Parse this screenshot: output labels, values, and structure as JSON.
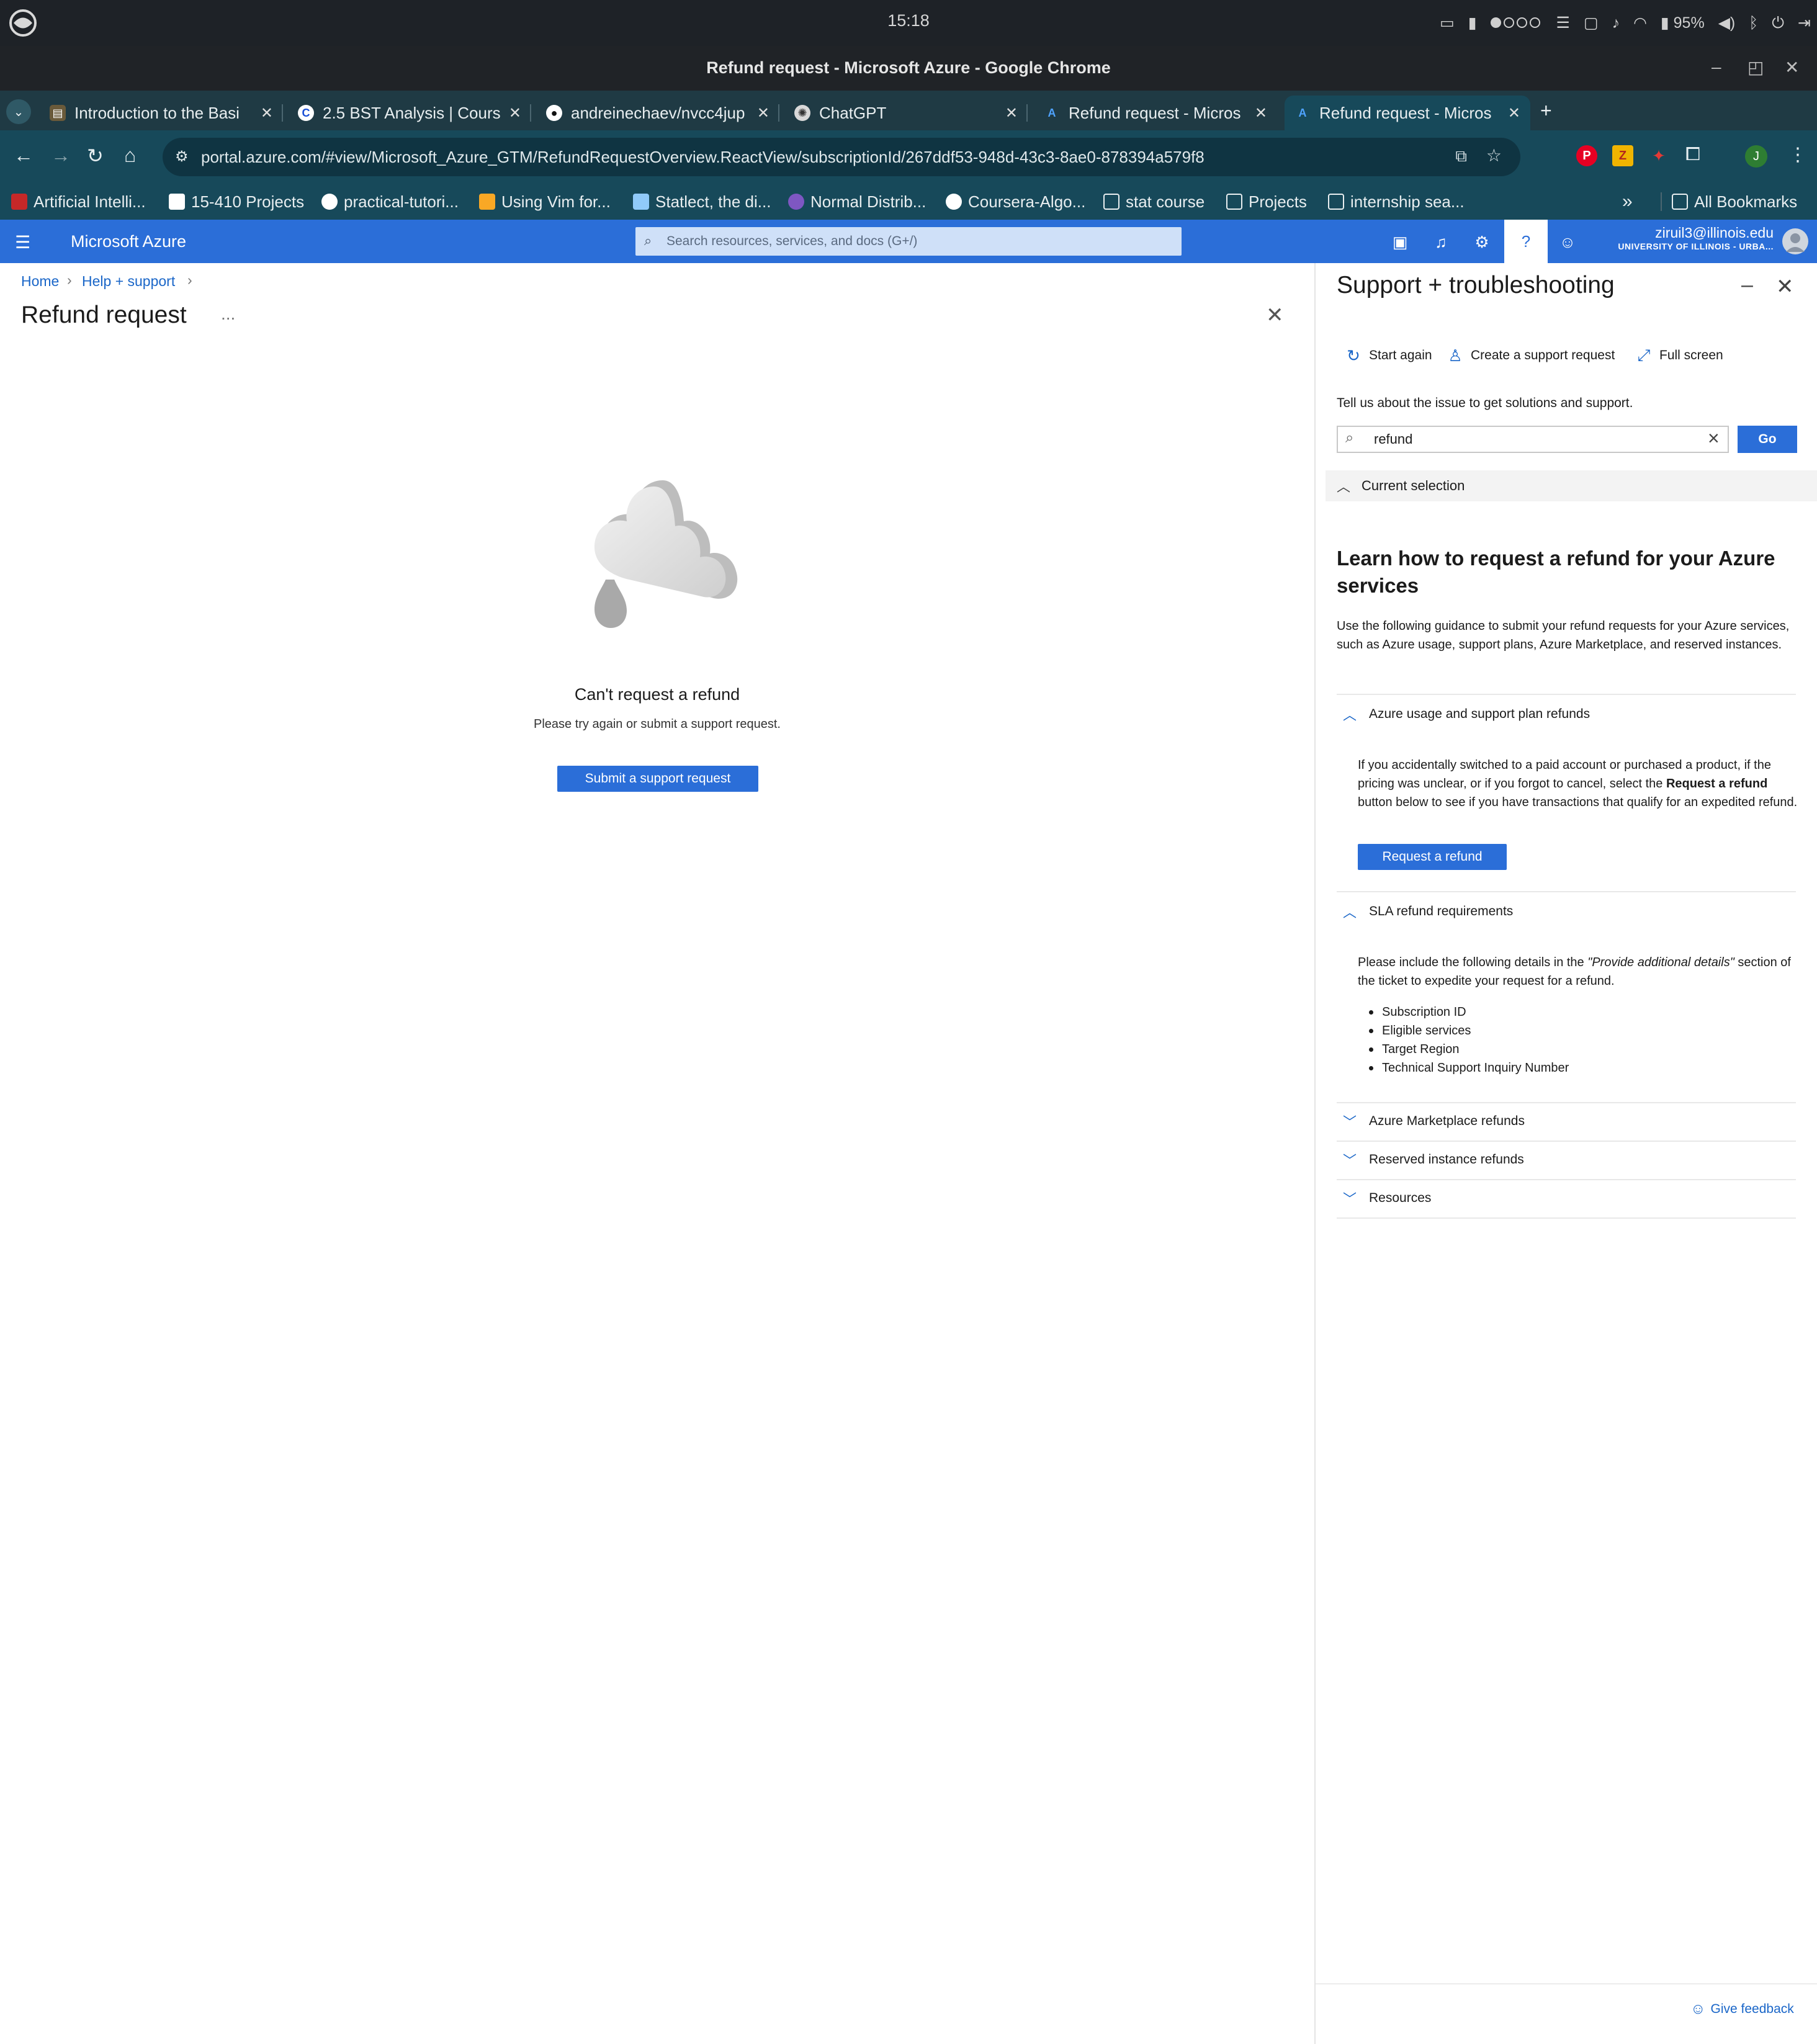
{
  "system_bar": {
    "time": "15:18",
    "battery": "95%"
  },
  "window": {
    "title": "Refund request - Microsoft Azure - Google Chrome"
  },
  "tabs": [
    {
      "label": "Introduction to the Basi",
      "favicon": "book-icon",
      "active": false
    },
    {
      "label": "2.5 BST Analysis | Cours",
      "favicon": "coursera-icon",
      "active": false
    },
    {
      "label": "andreinechaev/nvcc4jup",
      "favicon": "github-icon",
      "active": false
    },
    {
      "label": "ChatGPT",
      "favicon": "chatgpt-icon",
      "active": false
    },
    {
      "label": "Refund request - Micros",
      "favicon": "azure-icon",
      "active": false
    },
    {
      "label": "Refund request - Micros",
      "favicon": "azure-icon",
      "active": true
    }
  ],
  "address_bar": {
    "url": "portal.azure.com/#view/Microsoft_Azure_GTM/RefundRequestOverview.ReactView/subscriptionId/267ddf53-948d-43c3-8ae0-878394a579f8"
  },
  "bookmarks": [
    {
      "label": "Artificial Intelli...",
      "icon": "bookmark-favicon"
    },
    {
      "label": "15-410 Projects",
      "icon": "bookmark-favicon"
    },
    {
      "label": "practical-tutori...",
      "icon": "github-icon"
    },
    {
      "label": "Using Vim for...",
      "icon": "bookmark-favicon"
    },
    {
      "label": "Statlect, the di...",
      "icon": "bookmark-favicon"
    },
    {
      "label": "Normal Distrib...",
      "icon": "bookmark-favicon"
    },
    {
      "label": "Coursera-Algo...",
      "icon": "github-icon"
    },
    {
      "label": "stat course",
      "icon": "folder-icon"
    },
    {
      "label": "Projects",
      "icon": "folder-icon"
    },
    {
      "label": "internship sea...",
      "icon": "folder-icon"
    }
  ],
  "bookmarks_overflow": "»",
  "all_bookmarks": "All Bookmarks",
  "azure_header": {
    "brand": "Microsoft Azure",
    "search_placeholder": "Search resources, services, and docs (G+/)",
    "account_email": "ziruil3@illinois.edu",
    "account_org": "UNIVERSITY OF ILLINOIS - URBA..."
  },
  "main": {
    "breadcrumbs": [
      "Home",
      "Help + support"
    ],
    "title": "Refund request",
    "ellipsis": "...",
    "empty_title": "Can't request a refund",
    "empty_subtitle": "Please try again or submit a support request.",
    "submit_button": "Submit a support request"
  },
  "panel": {
    "title": "Support + troubleshooting",
    "toolbar": {
      "start_again": "Start again",
      "create_request": "Create a support request",
      "full_screen": "Full screen"
    },
    "prompt": "Tell us about the issue to get solutions and support.",
    "search_value": "refund",
    "go_button": "Go",
    "current_selection": "Current selection",
    "learn_title": "Learn how to request a refund for your Azure services",
    "learn_desc": "Use the following guidance to submit your refund requests for your Azure services, such as Azure usage, support plans, Azure Marketplace, and reserved instances.",
    "sections": {
      "usage": {
        "title": "Azure usage and support plan refunds",
        "body_pre": "If you accidentally switched to a paid account or purchased a product, if the pricing was unclear, or if you forgot to cancel, select the ",
        "body_bold": "Request a refund",
        "body_post": " button below to see if you have transactions that qualify for an expedited refund.",
        "button": "Request a refund"
      },
      "sla": {
        "title": "SLA refund requirements",
        "body_pre": "Please include the following details in the ",
        "body_italic": "\"Provide additional details\"",
        "body_post": " section of the ticket to expedite your request for a refund.",
        "bullets": [
          "Subscription ID",
          "Eligible services",
          "Target Region",
          "Technical Support Inquiry Number"
        ]
      },
      "marketplace": {
        "title": "Azure Marketplace refunds"
      },
      "reserved": {
        "title": "Reserved instance refunds"
      },
      "resources": {
        "title": "Resources"
      }
    },
    "give_feedback": "Give feedback"
  },
  "colors": {
    "azure_blue": "#2b6ed8",
    "link_blue": "#1a66c8",
    "chrome_tab_strip": "#1f3a44",
    "chrome_toolbar": "#17495a"
  }
}
